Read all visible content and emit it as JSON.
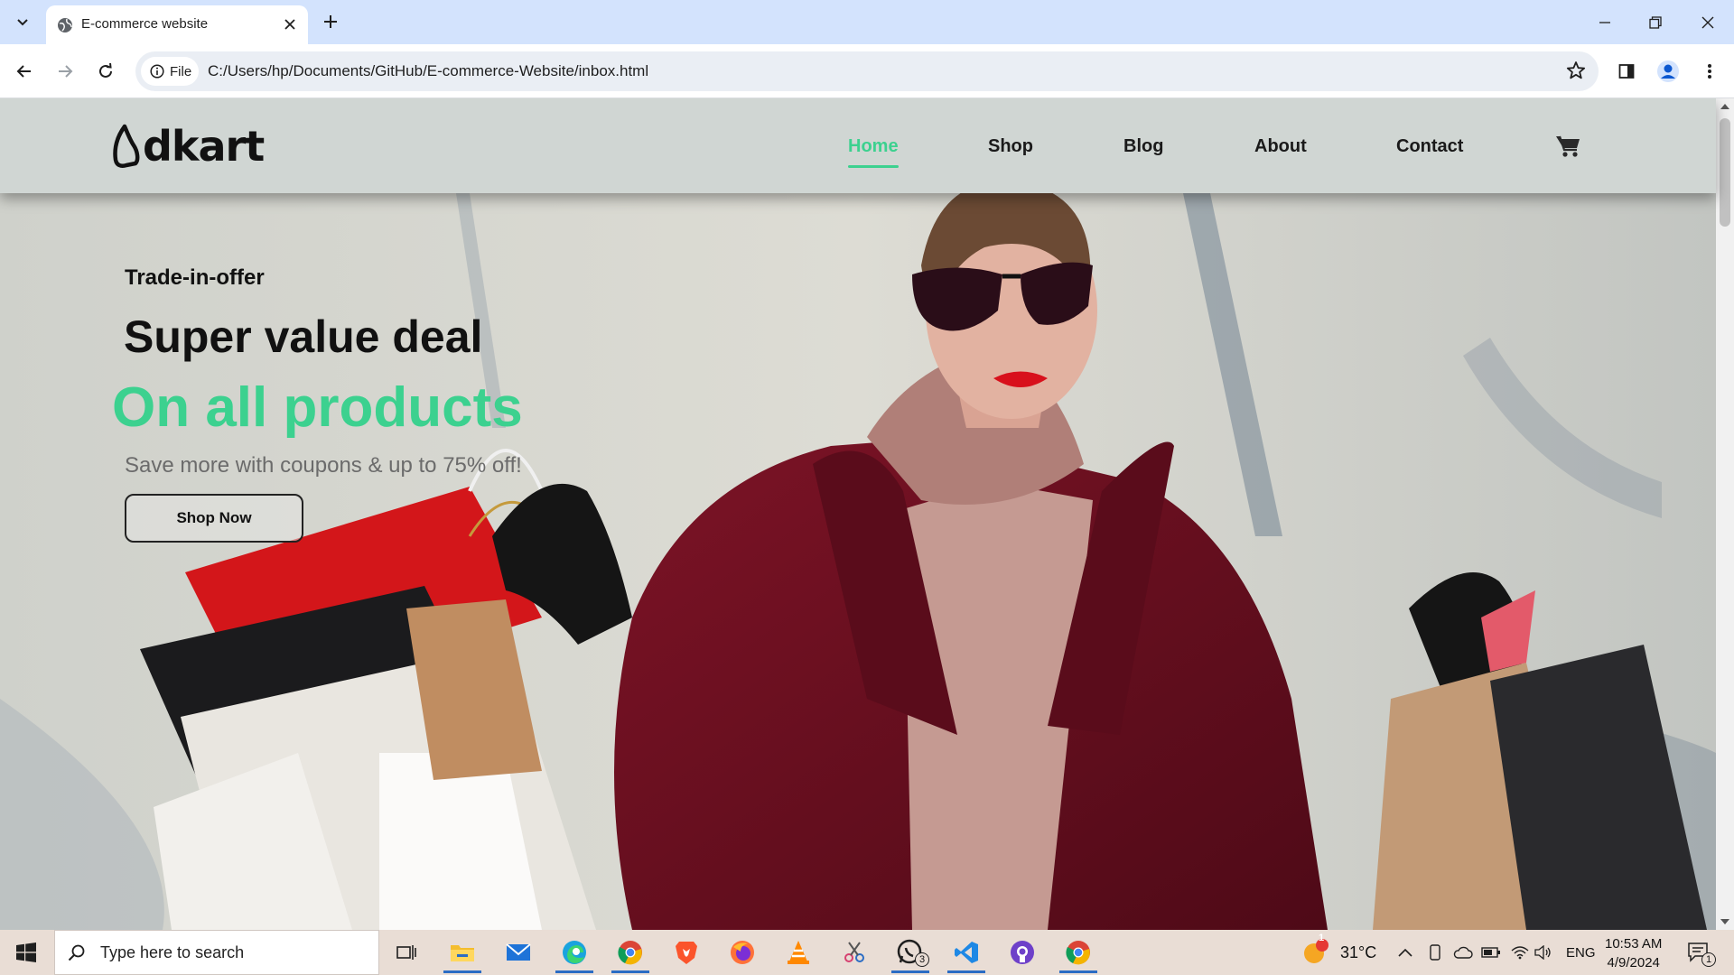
{
  "browser": {
    "tab_title": "E-commerce website",
    "url_chip": "File",
    "url": "C:/Users/hp/Documents/GitHub/E-commerce-Website/inbox.html"
  },
  "site": {
    "logo_text": "dkart",
    "nav": [
      {
        "label": "Home",
        "active": true
      },
      {
        "label": "Shop",
        "active": false
      },
      {
        "label": "Blog",
        "active": false
      },
      {
        "label": "About",
        "active": false
      },
      {
        "label": "Contact",
        "active": false
      }
    ],
    "cart_icon": "cart-icon",
    "accent_color": "#3cd18f"
  },
  "hero": {
    "subtitle": "Trade-in-offer",
    "title": "Super value deal",
    "highlight": "On all products",
    "description": "Save more with coupons & up to 75% off!",
    "button_label": "Shop Now"
  },
  "taskbar": {
    "search_placeholder": "Type here to search",
    "weather": "31°C",
    "weather_badge": "1",
    "language": "ENG",
    "time": "10:53 AM",
    "date": "4/9/2024",
    "whatsapp_badge": "3",
    "notification_count": "1"
  }
}
